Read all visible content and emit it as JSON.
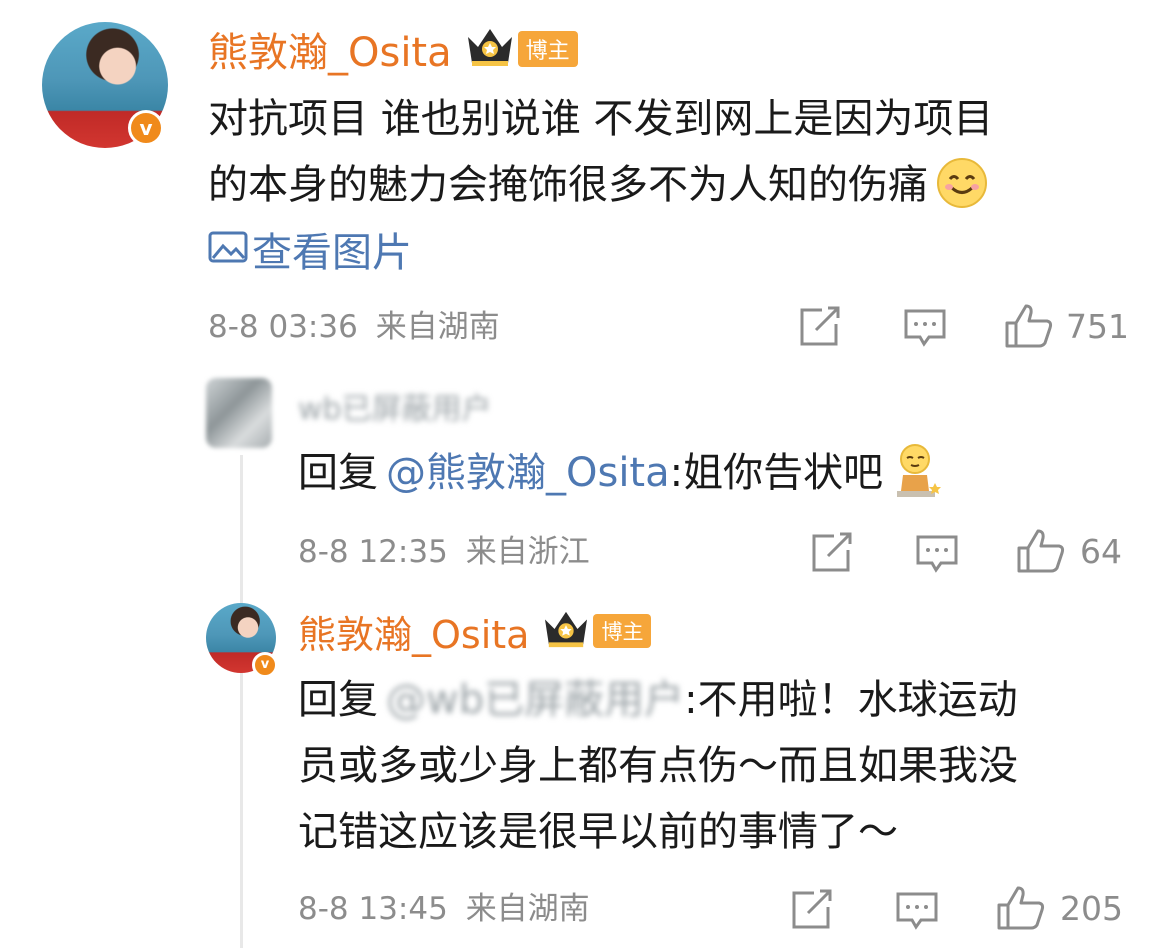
{
  "main_comment": {
    "username": "熊敦瀚_Osita",
    "badge": "博主",
    "verified_mark": "v",
    "text_line1": "对抗项目 谁也别说谁 不发到网上是因为项目",
    "text_line2": "的本身的魅力会掩饰很多不为人知的伤痛",
    "emoji": "☺",
    "view_image_label": "查看图片",
    "timestamp": "8-8 03:36",
    "location": "来自湖南",
    "likes": "751"
  },
  "reply1": {
    "username": "wb已屏蔽用户",
    "reply_prefix": "回复",
    "mention": "@熊敦瀚_Osita",
    "text": ":姐你告状吧",
    "emoji": "🧸",
    "timestamp": "8-8 12:35",
    "location": "来自浙江",
    "likes": "64"
  },
  "reply2": {
    "username": "熊敦瀚_Osita",
    "badge": "博主",
    "verified_mark": "v",
    "reply_prefix": "回复",
    "mention": "@wb已屏蔽用户",
    "text_line1": ":不用啦！水球运动",
    "text_line2": "员或多或少身上都有点伤～而且如果我没",
    "text_line3": "记错这应该是很早以前的事情了～",
    "timestamp": "8-8 13:45",
    "location": "来自湖南",
    "likes": "205"
  },
  "icons": [
    "share-icon",
    "comment-icon",
    "like-icon",
    "image-icon",
    "crown-icon"
  ],
  "colors": {
    "username": "#e87524",
    "link": "#4e78b2",
    "meta": "#8c8c8c",
    "badge": "#f6a63a"
  }
}
